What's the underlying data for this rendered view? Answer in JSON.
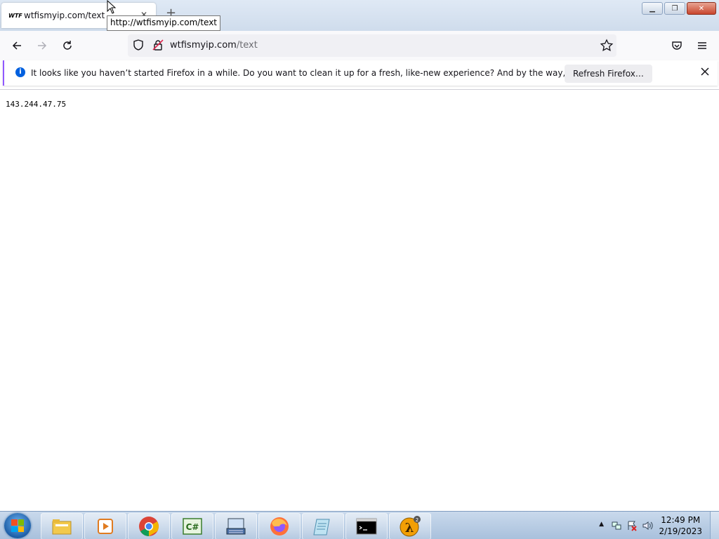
{
  "browser": {
    "tab": {
      "favicon_text": "WTF",
      "title": "wtfismyip.com/text"
    },
    "tooltip": "http://wtfismyip.com/text",
    "address": {
      "domain": "wtfismyip.com",
      "path": "/text"
    }
  },
  "notification": {
    "message": "It looks like you haven’t started Firefox in a while. Do you want to clean it up for a fresh, like-new experience? And by the way, welcome back!",
    "button_label": "Refresh Firefox…"
  },
  "page": {
    "ip_text": "143.244.47.75"
  },
  "taskbar": {
    "apps": [
      "file-explorer-icon",
      "media-player-icon",
      "chrome-icon",
      "csharp-icon",
      "keyboard-app-icon",
      "firefox-icon",
      "notepad-icon",
      "cmd-icon",
      "half-life-2-icon"
    ],
    "clock": {
      "time": "12:49 PM",
      "date": "2/19/2023"
    }
  }
}
